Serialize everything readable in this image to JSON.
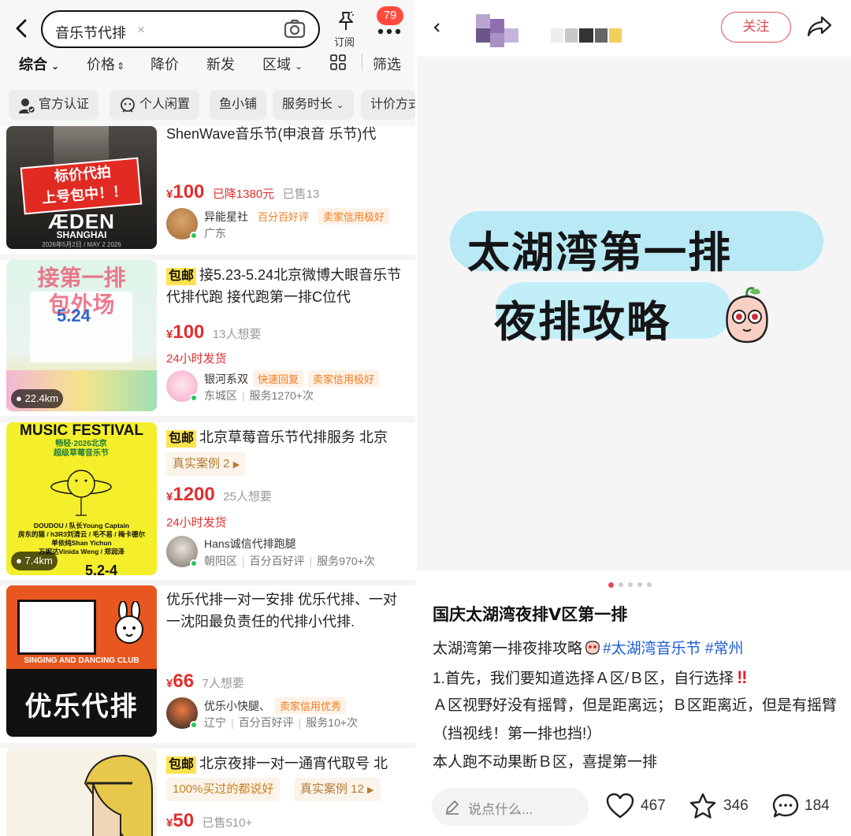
{
  "left": {
    "search": {
      "query": "音乐节代排",
      "clear": "×"
    },
    "subscribe_label": "订阅",
    "notification_count": "79",
    "sort_tabs": [
      "综合",
      "价格",
      "降价",
      "新发",
      "区域",
      "筛选"
    ],
    "filter_chips": [
      "官方认证",
      "个人闲置",
      "鱼小铺",
      "服务时长",
      "计价方式"
    ],
    "listings": [
      {
        "title": "ShenWave音乐节(申浪音 乐节)代",
        "currency": "¥",
        "price": "100",
        "meta": [
          "已降1380元",
          "已售13"
        ],
        "seller": {
          "name": "异能星社",
          "tags": [
            "百分百好评",
            "卖家信用极好"
          ],
          "location": [
            "广东"
          ]
        },
        "thumb": {
          "banner": "标价代拍\n上号包中！！",
          "brand": "ÆDEN",
          "city": "SHANGHAI",
          "date": "2026年5月2日 / MAY 2 2026"
        }
      },
      {
        "free_shipping": "包邮",
        "title": "接5.23-5.24北京微博大眼音乐节代排代跑 接代跑第一排C位代",
        "currency": "¥",
        "price": "100",
        "meta": [
          "13人想要"
        ],
        "shipping": "24小时发货",
        "seller": {
          "name": "银河系双",
          "tags": [
            "快速回复",
            "卖家信用极好"
          ],
          "location": [
            "东城区",
            "服务1270+次"
          ]
        },
        "thumb": {
          "overlay": "接第一排\n包外场",
          "date": "5.24",
          "distance": "22.4km"
        }
      },
      {
        "free_shipping": "包邮",
        "title": "北京草莓音乐节代排服务 北京",
        "badge": "真实案例 2",
        "currency": "¥",
        "price": "1200",
        "meta": [
          "25人想要"
        ],
        "shipping": "24小时发货",
        "seller": {
          "name": "Hans诚信代排跑腿",
          "tags": [],
          "location": [
            "朝阳区",
            "百分百好评",
            "服务970+次"
          ]
        },
        "thumb": {
          "headline": "MUSIC FESTIVAL",
          "sub": "畅轻·2026北京\n超级草莓音乐节",
          "lineup": "DOUDOU / 队长Young Captain\n房东的猫 / h3R3刘清云 / 毛不易 / 梅卡德尔\n单依纯Shan Yichun\n万妮达Vinida Weng / 郑润泽",
          "date": "5.2-4",
          "distance": "7.4km"
        }
      },
      {
        "title": "优乐代排一对一安排 优乐代排、一对一沈阳最负责任的代排小代排.",
        "currency": "¥",
        "price": "66",
        "meta": [
          "7人想要"
        ],
        "seller": {
          "name": "优乐小快腿、",
          "tags": [
            "卖家信用优秀"
          ],
          "location": [
            "辽宁",
            "百分百好评",
            "服务10+次"
          ]
        },
        "thumb": {
          "club": "SINGING AND DANCING CLUB",
          "brand": "优乐代排"
        }
      },
      {
        "free_shipping": "包邮",
        "title": "北京夜排一对一通宵代取号 北",
        "badges": [
          "100%买过的都说好",
          "真实案例 12"
        ],
        "currency": "¥",
        "price": "50",
        "meta": [
          "已售510+"
        ]
      }
    ]
  },
  "right": {
    "follow_label": "关注",
    "cover": {
      "line1": "太湖湾第一排",
      "line2": "夜排攻略"
    },
    "post_title": "国庆太湖湾夜排Ⅴ区第一排",
    "body": {
      "line1_text": "太湖湾第一排夜排攻略",
      "line1_hash1": "#太湖湾音乐节",
      "line1_hash2": "#常州",
      "line2": "1.首先，我们要知道选择Ａ区/Ｂ区，自行选择",
      "line2_mark": "‼",
      "line3": "Ａ区视野好没有摇臂，但是距离远；Ｂ区距离近，但是有摇臂（挡视线！第一排也挡!）",
      "line4": "本人跑不动果断Ｂ区，喜提第一排"
    },
    "comment_placeholder": "说点什么...",
    "likes": "467",
    "stars": "346",
    "comments": "184"
  }
}
